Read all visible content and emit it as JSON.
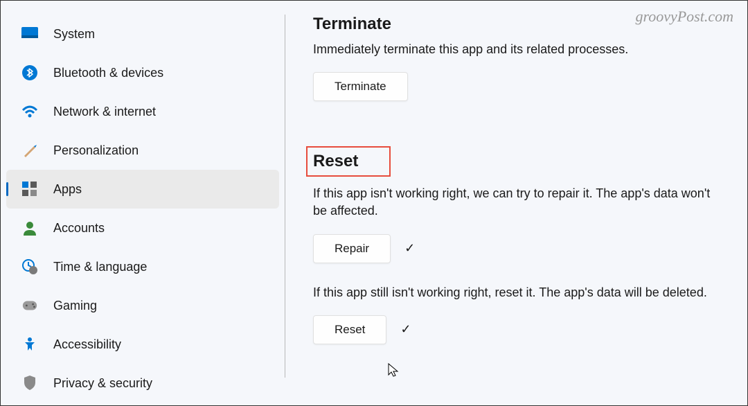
{
  "watermark": "groovyPost.com",
  "sidebar": {
    "items": [
      {
        "label": "System"
      },
      {
        "label": "Bluetooth & devices"
      },
      {
        "label": "Network & internet"
      },
      {
        "label": "Personalization"
      },
      {
        "label": "Apps"
      },
      {
        "label": "Accounts"
      },
      {
        "label": "Time & language"
      },
      {
        "label": "Gaming"
      },
      {
        "label": "Accessibility"
      },
      {
        "label": "Privacy & security"
      }
    ]
  },
  "content": {
    "terminate": {
      "heading": "Terminate",
      "description": "Immediately terminate this app and its related processes.",
      "button": "Terminate"
    },
    "reset": {
      "heading": "Reset",
      "repair_desc": "If this app isn't working right, we can try to repair it. The app's data won't be affected.",
      "repair_button": "Repair",
      "reset_desc": "If this app still isn't working right, reset it. The app's data will be deleted.",
      "reset_button": "Reset"
    }
  }
}
